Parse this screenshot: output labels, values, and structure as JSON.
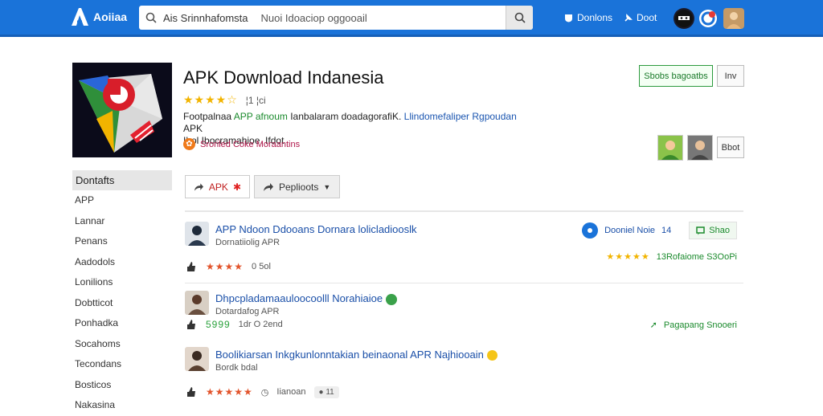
{
  "topbar": {
    "brand": "Aoiiaa",
    "search_value": "Ais Srinnhafomsta",
    "search_placeholder": "Nuoi Idoaciop oggooail",
    "nav_downloads": "Donlons",
    "nav_boot": "Doot"
  },
  "app": {
    "title": "APK Download Indanesia",
    "rating_count": "¦1 ¦ci",
    "desc_1": "Footpalnaa",
    "desc_2": "APP afnoum",
    "desc_3": "Ianbalaram doadagorafiK.",
    "desc_4": "Llindomefaliper Rgpoudan",
    "desc_5": "APK",
    "desc_6": "Ibol Ibocramahioe. Ifdot",
    "developer": "Sroriled Coke Moraantins",
    "install_button": "Sbobs bagoatbs",
    "follow_button": "Inv",
    "bot_button": "Bbot"
  },
  "sidebar": {
    "title": "Dontafts",
    "items": [
      "APP",
      "Lannar",
      "Penans",
      "Aadodols",
      "Lonilions",
      "Dobtticot",
      "Ponhadka",
      "Socahoms",
      "Tecondans",
      "Bosticos",
      "Nakasina"
    ]
  },
  "actions": {
    "apk": "APK",
    "share": "Peplioots"
  },
  "reviews": [
    {
      "title": "APP Ndoon Ddooans Dornara lolicladiooslk",
      "subtitle": "Dornatiiolig  APR",
      "meta": "0 5ol",
      "right_label": "Dooniel Noie",
      "right_count": "14",
      "share": "Shao",
      "right_stats": "13Rofaiome S3OoPi"
    },
    {
      "title": "Dhpcpladamaauloocoolll Norahiaioe",
      "subtitle": "Dotardafog APR",
      "meta_stars": "5999",
      "meta": "1dr  O 2end",
      "right_stats": "Pagapang   Snooeri"
    },
    {
      "title": "Boolikiarsan  Inkgkunlonntakian beinaonal  APR Najhiooain",
      "subtitle": "Bordk bdal",
      "meta": "Iianoan",
      "meta_badge": "11"
    }
  ]
}
